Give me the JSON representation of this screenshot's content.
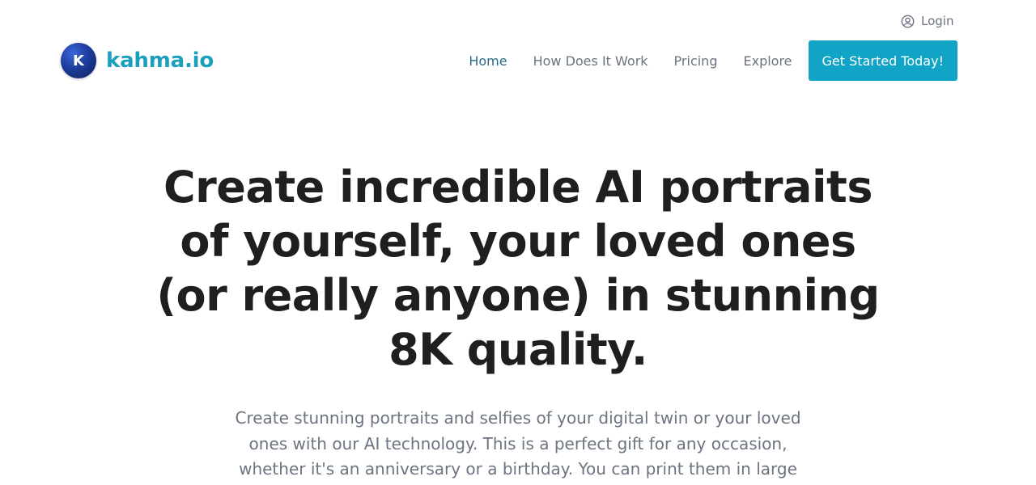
{
  "topbar": {
    "login_label": "Login",
    "login_icon": "user-circle-icon"
  },
  "header": {
    "logo_letter": "K",
    "brand_name": "kahma.io",
    "nav": [
      {
        "label": "Home",
        "active": true
      },
      {
        "label": "How Does It Work",
        "active": false
      },
      {
        "label": "Pricing",
        "active": false
      },
      {
        "label": "Explore",
        "active": false
      }
    ],
    "cta_label": "Get Started Today!"
  },
  "hero": {
    "title": "Create incredible AI portraits of yourself, your loved ones (or really anyone) in stunning 8K quality.",
    "subtitle": "Create stunning portraits and selfies of your digital twin or your loved ones with our AI technology. This is a perfect gift for any occasion, whether it's an anniversary or a birthday. You can print them in large"
  },
  "colors": {
    "brand": "#1b9fbe",
    "cta_background": "#12a4c7",
    "nav_active": "#2c6b87",
    "nav_default": "#6b7280",
    "heading": "#1f1f1f",
    "body_text": "#6b7480"
  }
}
